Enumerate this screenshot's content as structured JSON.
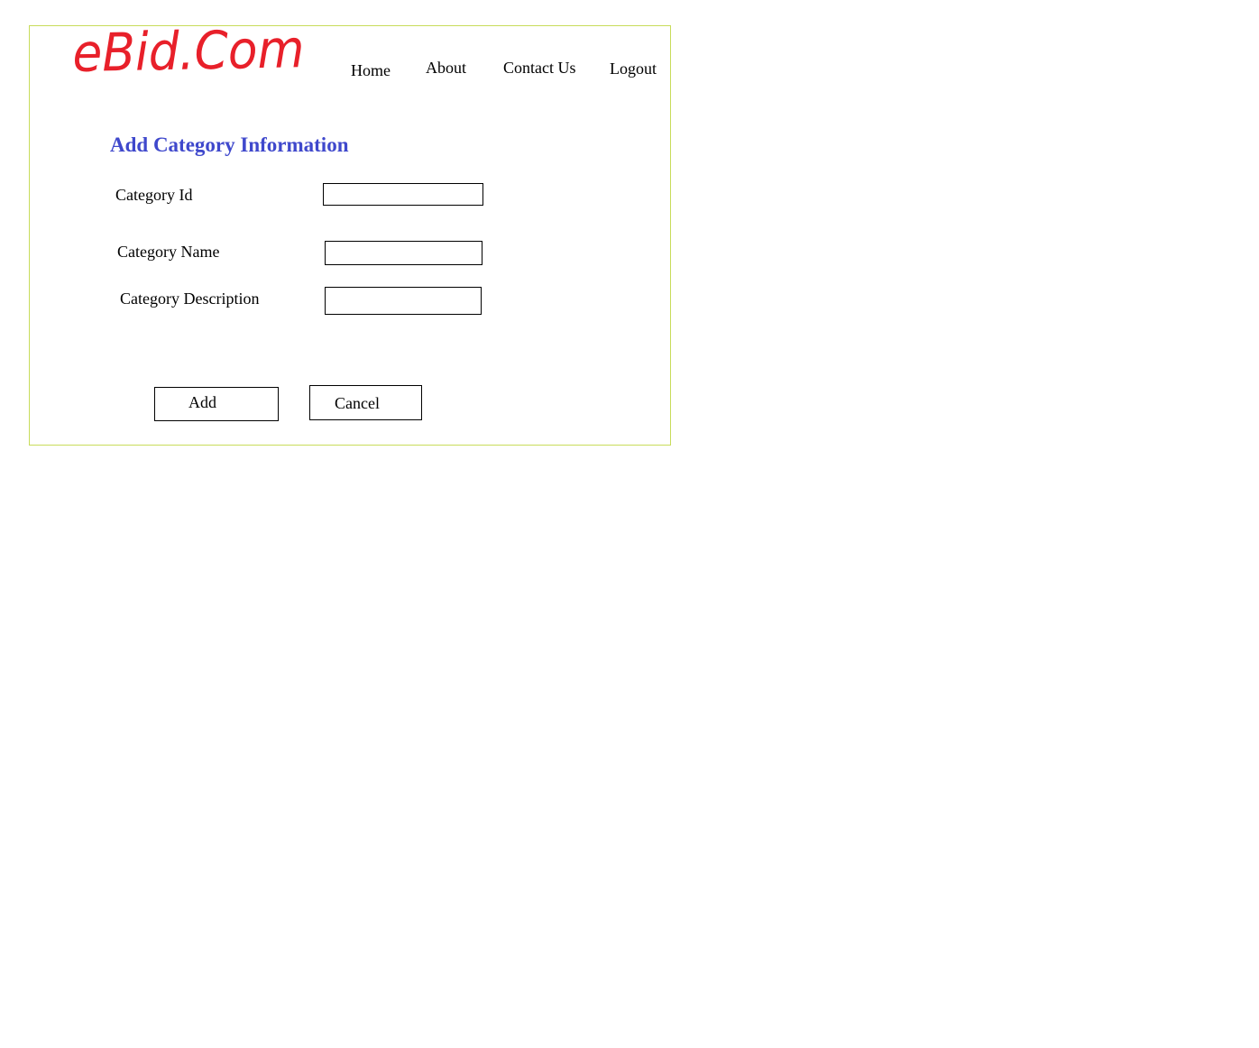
{
  "brand": {
    "logo_text": "eBid.Com",
    "logo_color": "#e8202a",
    "frame_border_color": "#c8dc5a",
    "title_color": "#3f48cc"
  },
  "nav": {
    "home": "Home",
    "about": "About",
    "contact": "Contact Us",
    "logout": "Logout"
  },
  "form": {
    "title": "Add Category Information",
    "fields": [
      {
        "label": "Category Id",
        "value": ""
      },
      {
        "label": "Category Name",
        "value": ""
      },
      {
        "label": "Category Description",
        "value": ""
      }
    ],
    "add_label": "Add",
    "cancel_label": "Cancel"
  }
}
